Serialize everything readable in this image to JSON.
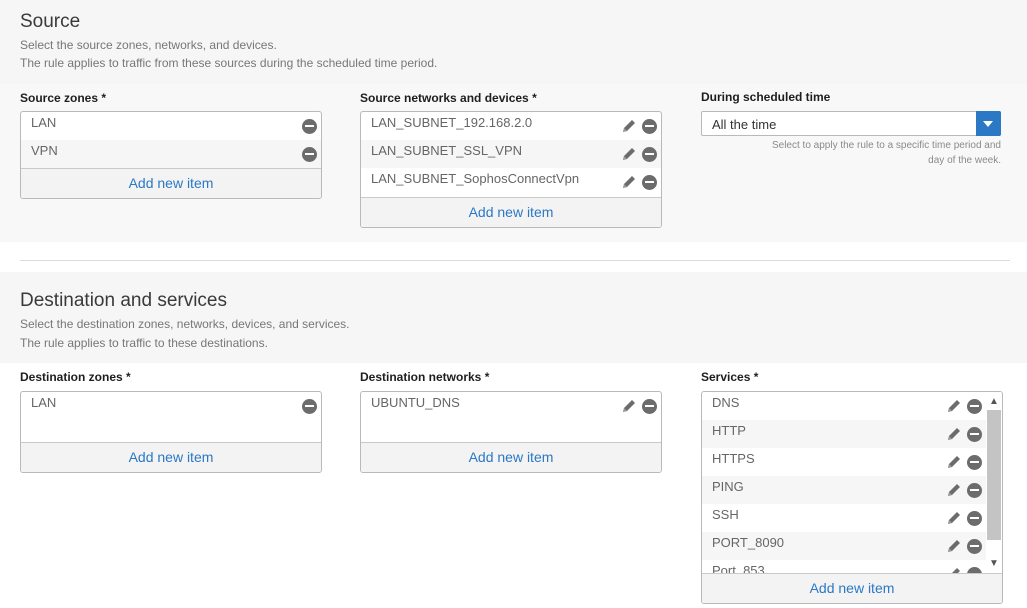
{
  "source": {
    "title": "Source",
    "desc1": "Select the source zones, networks, and devices.",
    "desc2": "The rule applies to traffic from these sources during the scheduled time period.",
    "zones": {
      "label": "Source zones *",
      "items": [
        "LAN",
        "VPN"
      ],
      "add": "Add new item"
    },
    "networks": {
      "label": "Source networks and devices *",
      "items": [
        "LAN_SUBNET_192.168.2.0",
        "LAN_SUBNET_SSL_VPN",
        "LAN_SUBNET_SophosConnectVpn"
      ],
      "add": "Add new item"
    },
    "schedule": {
      "label": "During scheduled time",
      "value": "All the time",
      "hint1": "Select to apply the rule to a specific time period and",
      "hint2": "day of the week."
    }
  },
  "destination": {
    "title": "Destination and services",
    "desc1": "Select the destination zones, networks, devices, and services.",
    "desc2": "The rule applies to traffic to these destinations.",
    "zones": {
      "label": "Destination zones *",
      "items": [
        "LAN"
      ],
      "add": "Add new item"
    },
    "networks": {
      "label": "Destination networks *",
      "items": [
        "UBUNTU_DNS"
      ],
      "add": "Add new item"
    },
    "services": {
      "label": "Services *",
      "items": [
        "DNS",
        "HTTP",
        "HTTPS",
        "PING",
        "SSH",
        "PORT_8090",
        "Port_853"
      ],
      "add": "Add new item"
    }
  },
  "colors": {
    "accent": "#2b78c5",
    "band": "#f6f6f6",
    "icon": "#6c6c6c"
  },
  "icons": {
    "edit": "pencil-icon",
    "remove": "minus-circle-icon",
    "dropdown": "chevron-down-icon",
    "scroll_up": "arrow-up-icon",
    "scroll_down": "arrow-down-icon"
  }
}
